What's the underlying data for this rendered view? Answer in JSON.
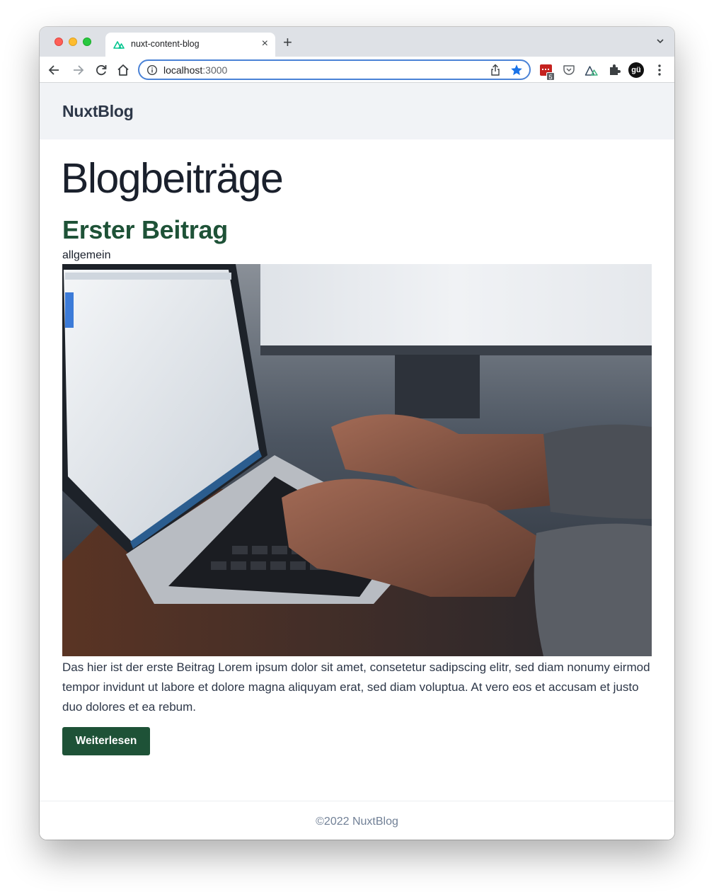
{
  "browser": {
    "tab_title": "nuxt-content-blog",
    "new_tab_label": "+",
    "url_host": "localhost",
    "url_port": ":3000",
    "extension_badge": "5",
    "profile_initials": "gü",
    "accent_color": "#1a73e8",
    "icons": [
      "back-icon",
      "forward-icon",
      "reload-icon",
      "home-icon",
      "info-icon",
      "share-icon",
      "star-icon",
      "extensions-icon",
      "menu-icon"
    ]
  },
  "site": {
    "brand": "NuxtBlog",
    "page_title": "Blogbeiträge",
    "brand_color": "#1e5237",
    "footer": "©2022 NuxtBlog"
  },
  "posts": [
    {
      "title": "Erster Beitrag",
      "category": "allgemein",
      "excerpt": "Das hier ist der erste Beitrag Lorem ipsum dolor sit amet, consetetur sadipscing elitr, sed diam nonumy eirmod tempor invidunt ut labore et dolore magna aliquyam erat, sed diam voluptua. At vero eos et accusam et justo duo dolores et ea rebum.",
      "button_label": "Weiterlesen"
    }
  ]
}
